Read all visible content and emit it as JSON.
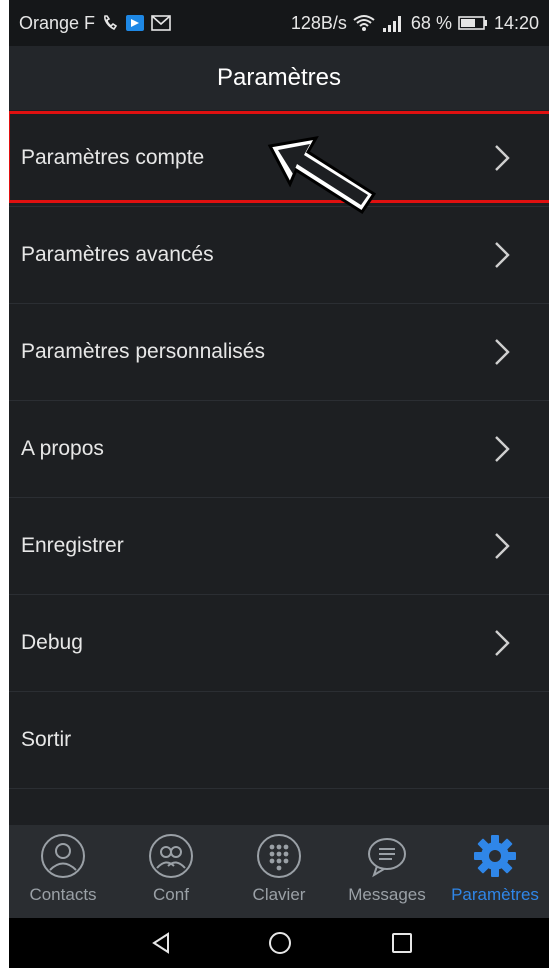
{
  "status_bar": {
    "carrier": "Orange F",
    "net_speed": "128B/s",
    "battery_percent": "68 %",
    "time": "14:20"
  },
  "app_bar": {
    "title": "Paramètres"
  },
  "menu": {
    "items": [
      {
        "label": "Paramètres compte",
        "has_chevron": true
      },
      {
        "label": "Paramètres avancés",
        "has_chevron": true
      },
      {
        "label": "Paramètres personnalisés",
        "has_chevron": true
      },
      {
        "label": "A propos",
        "has_chevron": true
      },
      {
        "label": "Enregistrer",
        "has_chevron": true
      },
      {
        "label": "Debug",
        "has_chevron": true
      },
      {
        "label": "Sortir",
        "has_chevron": false
      }
    ]
  },
  "tabs": [
    {
      "label": "Contacts",
      "icon": "person-icon",
      "active": false
    },
    {
      "label": "Conf",
      "icon": "group-icon",
      "active": false
    },
    {
      "label": "Clavier",
      "icon": "dialpad-icon",
      "active": false
    },
    {
      "label": "Messages",
      "icon": "chat-bubble-icon",
      "active": false
    },
    {
      "label": "Paramètres",
      "icon": "gear-icon",
      "active": true
    }
  ],
  "colors": {
    "accent": "#2f86e8",
    "highlight": "#e01010",
    "background": "#1d1f22"
  }
}
